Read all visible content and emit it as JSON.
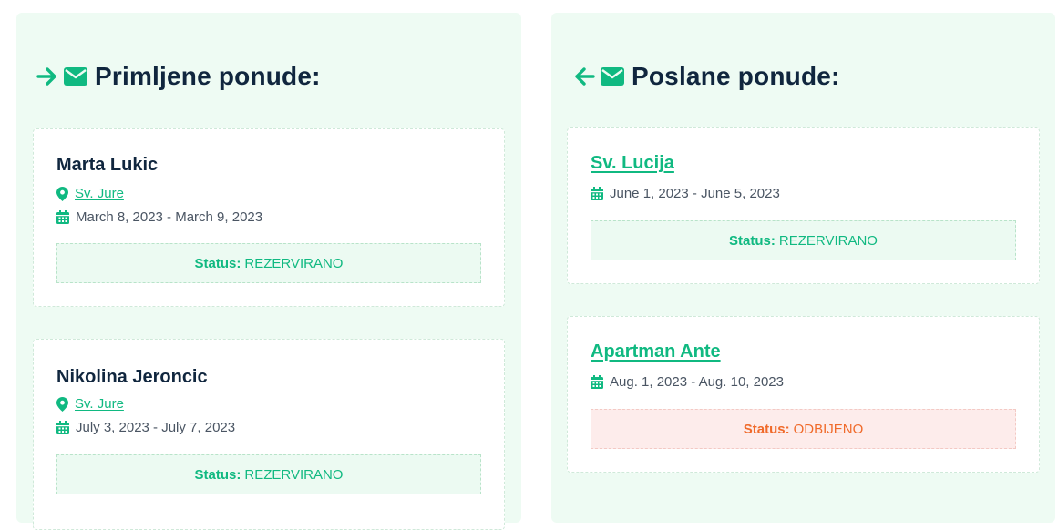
{
  "received": {
    "title": "Primljene ponude:",
    "offers": [
      {
        "name": "Marta Lukic",
        "location": "Sv. Jure",
        "dates": "March 8, 2023 - March 9, 2023",
        "status_label": "Status:",
        "status_value": "REZERVIRANO"
      },
      {
        "name": "Nikolina Jeroncic",
        "location": "Sv. Jure",
        "dates": "July 3, 2023 - July 7, 2023",
        "status_label": "Status:",
        "status_value": "REZERVIRANO"
      }
    ]
  },
  "sent": {
    "title": "Poslane ponude:",
    "offers": [
      {
        "property": "Sv. Lucija",
        "dates": "June 1, 2023 - June 5, 2023",
        "status_label": "Status:",
        "status_value": "REZERVIRANO"
      },
      {
        "property": "Apartman Ante",
        "dates": "Aug. 1, 2023 - Aug. 10, 2023",
        "status_label": "Status:",
        "status_value": "ODBIJENO"
      }
    ]
  },
  "colors": {
    "accent": "#10b981",
    "heading": "#10263e",
    "panel_bg": "#eefbf3",
    "rejected_text": "#f06a2a",
    "rejected_bg": "#fdeceb"
  }
}
